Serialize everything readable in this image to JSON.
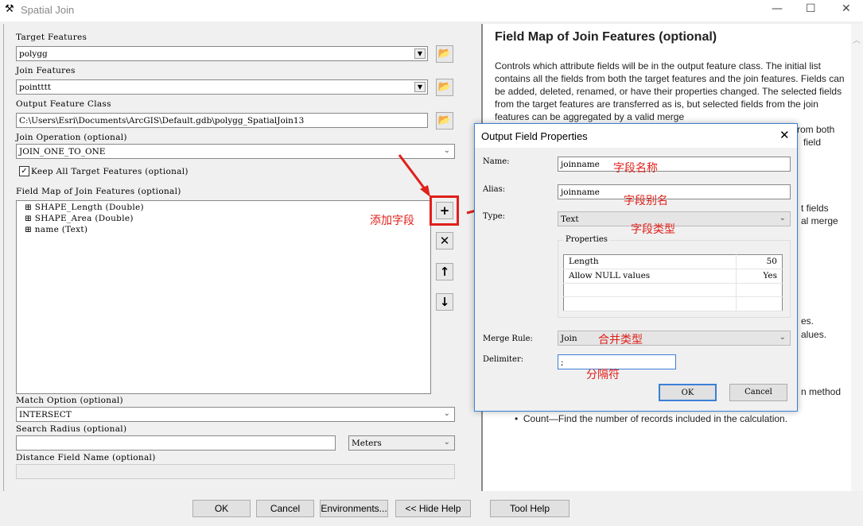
{
  "window": {
    "title": "Spatial Join",
    "minimize": "—",
    "maximize": "☐",
    "close": "✕"
  },
  "form": {
    "target_label": "Target Features",
    "target_value": "polygg",
    "join_label": "Join Features",
    "join_value": "pointttt",
    "output_label": "Output Feature Class",
    "output_value": "C:\\Users\\Esri\\Documents\\ArcGIS\\Default.gdb\\polygg_SpatialJoin13",
    "operation_label": "Join Operation (optional)",
    "operation_value": "JOIN_ONE_TO_ONE",
    "keep_all_label": "Keep All Target Features (optional)",
    "keep_all_checked": true,
    "fieldmap_label": "Field Map of Join Features (optional)",
    "fields": [
      "SHAPE_Length (Double)",
      "SHAPE_Area (Double)",
      "name (Text)"
    ],
    "match_label": "Match Option (optional)",
    "match_value": "INTERSECT",
    "radius_label": "Search Radius (optional)",
    "radius_value": "",
    "radius_unit": "Meters",
    "distance_label": "Distance Field Name (optional)",
    "distance_value": ""
  },
  "annotations": {
    "add_field": "添加字段",
    "name": "字段名称",
    "alias": "字段别名",
    "type": "字段类型",
    "merge": "合并类型",
    "delimiter": "分隔符",
    "accent": "#e0201a"
  },
  "help": {
    "title": "Field Map of Join Features (optional)",
    "body": "Controls which attribute fields will be in the output feature class. The initial list contains all the fields from both the target features and the join features. Fields can be added, deleted, renamed, or have their properties changed. The selected fields from the target features are transferred as is, but selected fields from the join features can be aggregated by a valid merge",
    "frag1": "rom both",
    "frag2": "field",
    "frag3": "t fields",
    "frag4": "al merge",
    "frag5": "es.",
    "frag6": "alues.",
    "frag7": "n method",
    "bullet": "Count—Find the number of records included in the calculation."
  },
  "buttons": {
    "ok": "OK",
    "cancel": "Cancel",
    "environments": "Environments...",
    "hide_help": "<< Hide Help",
    "tool_help": "Tool Help"
  },
  "dialog": {
    "title": "Output Field Properties",
    "name_label": "Name:",
    "name_value": "joinname",
    "alias_label": "Alias:",
    "alias_value": "joinname",
    "type_label": "Type:",
    "type_value": "Text",
    "properties_label": "Properties",
    "properties": [
      {
        "key": "Length",
        "value": "50"
      },
      {
        "key": "Allow NULL values",
        "value": "Yes"
      }
    ],
    "merge_label": "Merge Rule:",
    "merge_value": "Join",
    "delimiter_label": "Delimiter:",
    "delimiter_value": ";",
    "ok": "OK",
    "cancel": "Cancel"
  }
}
